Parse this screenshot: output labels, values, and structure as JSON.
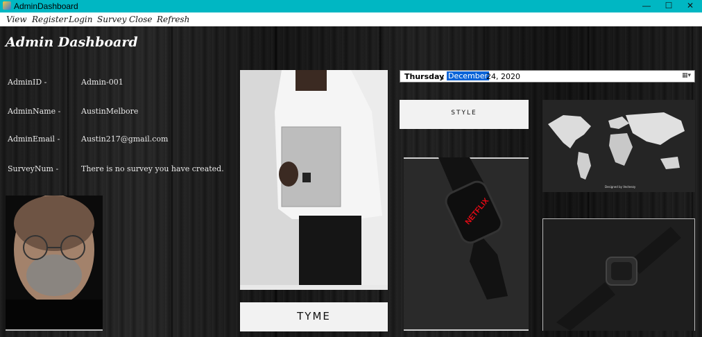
{
  "window": {
    "title": "AdminDashboard",
    "controls": [
      "—",
      "☐",
      "✕"
    ]
  },
  "menu": [
    "View",
    "Register",
    "Login",
    "Survey",
    "Close",
    "Refresh"
  ],
  "header": {
    "title": "Admin Dashboard"
  },
  "fields": [
    {
      "label": "AdminID -",
      "value": "Admin-001"
    },
    {
      "label": "AdminName -",
      "value": "AustinMelbore"
    },
    {
      "label": "AdminEmail -",
      "value": "Austin217@gmail.com"
    },
    {
      "label": "SurveyNum -",
      "value": "There is no survey you have created."
    }
  ],
  "date_picker": {
    "day": "Thursday",
    "comma": ",",
    "month": "December",
    "rest": "24, 2020"
  },
  "images": {
    "style_logo": "STYLE",
    "tyme_logo": "TYME",
    "watch_brand": "NETFLIX",
    "map_caption": "Designed by Vecteezy"
  }
}
